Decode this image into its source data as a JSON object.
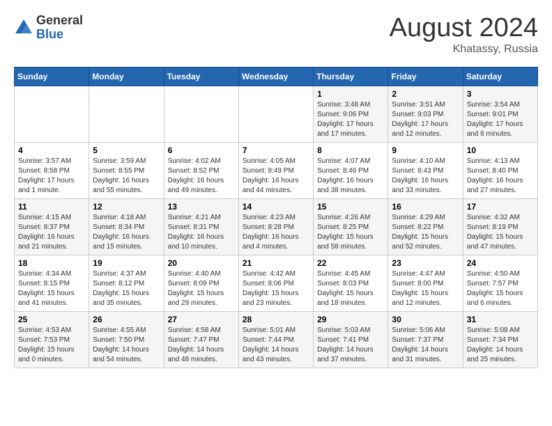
{
  "header": {
    "logo_general": "General",
    "logo_blue": "Blue",
    "month_year": "August 2024",
    "location": "Khatassy, Russia"
  },
  "days_of_week": [
    "Sunday",
    "Monday",
    "Tuesday",
    "Wednesday",
    "Thursday",
    "Friday",
    "Saturday"
  ],
  "weeks": [
    [
      {
        "day": "",
        "info": ""
      },
      {
        "day": "",
        "info": ""
      },
      {
        "day": "",
        "info": ""
      },
      {
        "day": "",
        "info": ""
      },
      {
        "day": "1",
        "info": "Sunrise: 3:48 AM\nSunset: 9:06 PM\nDaylight: 17 hours\nand 17 minutes."
      },
      {
        "day": "2",
        "info": "Sunrise: 3:51 AM\nSunset: 9:03 PM\nDaylight: 17 hours\nand 12 minutes."
      },
      {
        "day": "3",
        "info": "Sunrise: 3:54 AM\nSunset: 9:01 PM\nDaylight: 17 hours\nand 6 minutes."
      }
    ],
    [
      {
        "day": "4",
        "info": "Sunrise: 3:57 AM\nSunset: 8:58 PM\nDaylight: 17 hours\nand 1 minute."
      },
      {
        "day": "5",
        "info": "Sunrise: 3:59 AM\nSunset: 8:55 PM\nDaylight: 16 hours\nand 55 minutes."
      },
      {
        "day": "6",
        "info": "Sunrise: 4:02 AM\nSunset: 8:52 PM\nDaylight: 16 hours\nand 49 minutes."
      },
      {
        "day": "7",
        "info": "Sunrise: 4:05 AM\nSunset: 8:49 PM\nDaylight: 16 hours\nand 44 minutes."
      },
      {
        "day": "8",
        "info": "Sunrise: 4:07 AM\nSunset: 8:46 PM\nDaylight: 16 hours\nand 38 minutes."
      },
      {
        "day": "9",
        "info": "Sunrise: 4:10 AM\nSunset: 8:43 PM\nDaylight: 16 hours\nand 33 minutes."
      },
      {
        "day": "10",
        "info": "Sunrise: 4:13 AM\nSunset: 8:40 PM\nDaylight: 16 hours\nand 27 minutes."
      }
    ],
    [
      {
        "day": "11",
        "info": "Sunrise: 4:15 AM\nSunset: 8:37 PM\nDaylight: 16 hours\nand 21 minutes."
      },
      {
        "day": "12",
        "info": "Sunrise: 4:18 AM\nSunset: 8:34 PM\nDaylight: 16 hours\nand 15 minutes."
      },
      {
        "day": "13",
        "info": "Sunrise: 4:21 AM\nSunset: 8:31 PM\nDaylight: 16 hours\nand 10 minutes."
      },
      {
        "day": "14",
        "info": "Sunrise: 4:23 AM\nSunset: 8:28 PM\nDaylight: 16 hours\nand 4 minutes."
      },
      {
        "day": "15",
        "info": "Sunrise: 4:26 AM\nSunset: 8:25 PM\nDaylight: 15 hours\nand 58 minutes."
      },
      {
        "day": "16",
        "info": "Sunrise: 4:29 AM\nSunset: 8:22 PM\nDaylight: 15 hours\nand 52 minutes."
      },
      {
        "day": "17",
        "info": "Sunrise: 4:32 AM\nSunset: 8:19 PM\nDaylight: 15 hours\nand 47 minutes."
      }
    ],
    [
      {
        "day": "18",
        "info": "Sunrise: 4:34 AM\nSunset: 8:15 PM\nDaylight: 15 hours\nand 41 minutes."
      },
      {
        "day": "19",
        "info": "Sunrise: 4:37 AM\nSunset: 8:12 PM\nDaylight: 15 hours\nand 35 minutes."
      },
      {
        "day": "20",
        "info": "Sunrise: 4:40 AM\nSunset: 8:09 PM\nDaylight: 15 hours\nand 29 minutes."
      },
      {
        "day": "21",
        "info": "Sunrise: 4:42 AM\nSunset: 8:06 PM\nDaylight: 15 hours\nand 23 minutes."
      },
      {
        "day": "22",
        "info": "Sunrise: 4:45 AM\nSunset: 8:03 PM\nDaylight: 15 hours\nand 18 minutes."
      },
      {
        "day": "23",
        "info": "Sunrise: 4:47 AM\nSunset: 8:00 PM\nDaylight: 15 hours\nand 12 minutes."
      },
      {
        "day": "24",
        "info": "Sunrise: 4:50 AM\nSunset: 7:57 PM\nDaylight: 15 hours\nand 6 minutes."
      }
    ],
    [
      {
        "day": "25",
        "info": "Sunrise: 4:53 AM\nSunset: 7:53 PM\nDaylight: 15 hours\nand 0 minutes."
      },
      {
        "day": "26",
        "info": "Sunrise: 4:55 AM\nSunset: 7:50 PM\nDaylight: 14 hours\nand 54 minutes."
      },
      {
        "day": "27",
        "info": "Sunrise: 4:58 AM\nSunset: 7:47 PM\nDaylight: 14 hours\nand 48 minutes."
      },
      {
        "day": "28",
        "info": "Sunrise: 5:01 AM\nSunset: 7:44 PM\nDaylight: 14 hours\nand 43 minutes."
      },
      {
        "day": "29",
        "info": "Sunrise: 5:03 AM\nSunset: 7:41 PM\nDaylight: 14 hours\nand 37 minutes."
      },
      {
        "day": "30",
        "info": "Sunrise: 5:06 AM\nSunset: 7:37 PM\nDaylight: 14 hours\nand 31 minutes."
      },
      {
        "day": "31",
        "info": "Sunrise: 5:08 AM\nSunset: 7:34 PM\nDaylight: 14 hours\nand 25 minutes."
      }
    ]
  ]
}
